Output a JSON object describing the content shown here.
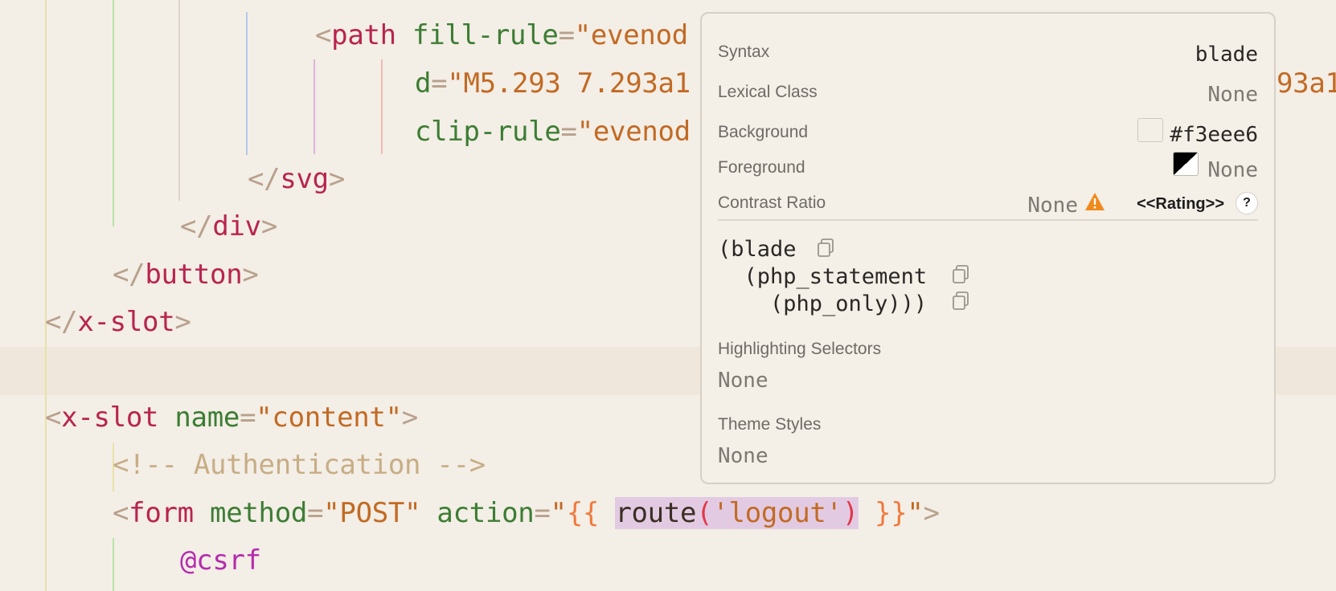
{
  "editor": {
    "lines": [
      {
        "tokens": [
          {
            "t": "<",
            "c": "punc"
          },
          {
            "t": "path",
            "c": "tag"
          },
          {
            "t": " fill-rule",
            "c": "attr"
          },
          {
            "t": "=",
            "c": "punc"
          },
          {
            "t": "\"evenod",
            "c": "str"
          }
        ]
      },
      {
        "tokens": [
          {
            "t": "d",
            "c": "attr"
          },
          {
            "t": "=",
            "c": "punc"
          },
          {
            "t": "\"M5.293 7.293a1",
            "c": "str"
          }
        ]
      },
      {
        "tokens": [
          {
            "t": "clip-rule",
            "c": "attr"
          },
          {
            "t": "=",
            "c": "punc"
          },
          {
            "t": "\"evenod",
            "c": "str"
          }
        ]
      },
      {
        "tokens": [
          {
            "t": "</",
            "c": "punc"
          },
          {
            "t": "svg",
            "c": "tag"
          },
          {
            "t": ">",
            "c": "punc"
          }
        ]
      },
      {
        "tokens": [
          {
            "t": "</",
            "c": "punc"
          },
          {
            "t": "div",
            "c": "tag"
          },
          {
            "t": ">",
            "c": "punc"
          }
        ]
      },
      {
        "tokens": [
          {
            "t": "</",
            "c": "punc"
          },
          {
            "t": "button",
            "c": "tag"
          },
          {
            "t": ">",
            "c": "punc"
          }
        ]
      },
      {
        "tokens": [
          {
            "t": "</",
            "c": "punc"
          },
          {
            "t": "x-slot",
            "c": "tag"
          },
          {
            "t": ">",
            "c": "punc"
          }
        ]
      },
      {
        "tokens": []
      },
      {
        "tokens": [
          {
            "t": "<",
            "c": "punc"
          },
          {
            "t": "x-slot",
            "c": "tag"
          },
          {
            "t": " name",
            "c": "attr"
          },
          {
            "t": "=",
            "c": "punc"
          },
          {
            "t": "\"content\"",
            "c": "str"
          },
          {
            "t": ">",
            "c": "punc"
          }
        ]
      },
      {
        "tokens": [
          {
            "t": "<!-- Authentication -->",
            "c": "cmt"
          }
        ]
      },
      {
        "tokens": [
          {
            "t": "<",
            "c": "punc"
          },
          {
            "t": "form",
            "c": "tag"
          },
          {
            "t": " method",
            "c": "attr"
          },
          {
            "t": "=",
            "c": "punc"
          },
          {
            "t": "\"POST\"",
            "c": "str"
          },
          {
            "t": " action",
            "c": "attr"
          },
          {
            "t": "=",
            "c": "punc"
          },
          {
            "t": "\"",
            "c": "str"
          },
          {
            "t": "{{ ",
            "c": "brk"
          },
          {
            "t": "route",
            "c": "fn sel"
          },
          {
            "t": "(",
            "c": "paren sel"
          },
          {
            "t": "'logout'",
            "c": "str sel"
          },
          {
            "t": ")",
            "c": "paren sel"
          },
          {
            "t": " }}",
            "c": "brk"
          },
          {
            "t": "\"",
            "c": "str"
          },
          {
            "t": ">",
            "c": "punc"
          }
        ]
      },
      {
        "tokens": [
          {
            "t": "@csrf",
            "c": "dir"
          }
        ]
      }
    ],
    "right_fragment": "93a1"
  },
  "inspector": {
    "syntax_label": "Syntax",
    "syntax_value": "blade",
    "lexical_label": "Lexical Class",
    "lexical_value": "None",
    "background_label": "Background",
    "background_value": "#f3eee6",
    "foreground_label": "Foreground",
    "foreground_value": "None",
    "contrast_label": "Contrast Ratio",
    "contrast_value": "None",
    "rating_label": "<<Rating>>",
    "help_label": "?",
    "tree": [
      "(blade",
      "  (php_statement",
      "    (php_only)))"
    ],
    "highlighting_label": "Highlighting Selectors",
    "highlighting_value": "None",
    "theme_label": "Theme Styles",
    "theme_value": "None",
    "colors": {
      "background": "#f3eee6",
      "warning": "#f08a1c"
    }
  }
}
